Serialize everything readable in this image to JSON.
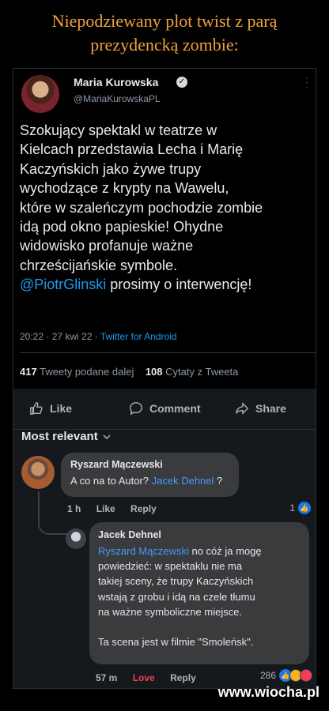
{
  "page": {
    "title_line1": "Niepodziewany plot twist z parą",
    "title_line2": "prezydencką zombie:"
  },
  "tweet": {
    "author": "Maria Kurowska",
    "handle": "@MariaKurowskaPL",
    "text_main": "Szokujący spektakl w teatrze w\nKielcach przedstawia Lecha i Marię\nKaczyńskich jako żywe trupy\nwychodzące z krypty na Wawelu,\nktóre w szaleńczym pochodzie zombie\nidą pod okno papieskie! Ohydne\nwidowisko profanuje ważne\nchrześcijańskie symbole.\n",
    "mention": "@PiotrGlinski",
    "text_end": " prosimy o interwencję!",
    "meta_time": "20:22 · 27 kwi 22 · ",
    "meta_source": "Twitter for Android",
    "retweets_count": "417",
    "retweets_label": "Tweety podane dalej",
    "quotes_count": "108",
    "quotes_label": "Cytaty z Tweeta"
  },
  "actions": {
    "like": "Like",
    "comment": "Comment",
    "share": "Share"
  },
  "sort_label": "Most relevant",
  "comment1": {
    "author": "Ryszard Mączewski",
    "text_before": "A co na to Autor? ",
    "link": "Jacek Dehnel",
    "text_after": " ?",
    "time": "1 h",
    "like": "Like",
    "reply": "Reply",
    "reactions": "1"
  },
  "comment2": {
    "author": "Jacek Dehnel",
    "link": "Ryszard Mączewski",
    "text": " no cóż ja mogę\npowiedzieć: w spektaklu nie ma\ntakiej sceny, że trupy Kaczyńskich\nwstają z grobu i idą na czele tłumu\nna ważne symboliczne miejsce.\n\nTa scena jest w filmie \"Smoleńsk\".",
    "time": "57 m",
    "love": "Love",
    "reply": "Reply",
    "reactions": "286"
  },
  "watermark": "www.wiocha.pl",
  "colors": {
    "title": "#f0a23a",
    "link": "#1d9bf0",
    "fb_link": "#4599ff",
    "love": "#f33e58"
  }
}
